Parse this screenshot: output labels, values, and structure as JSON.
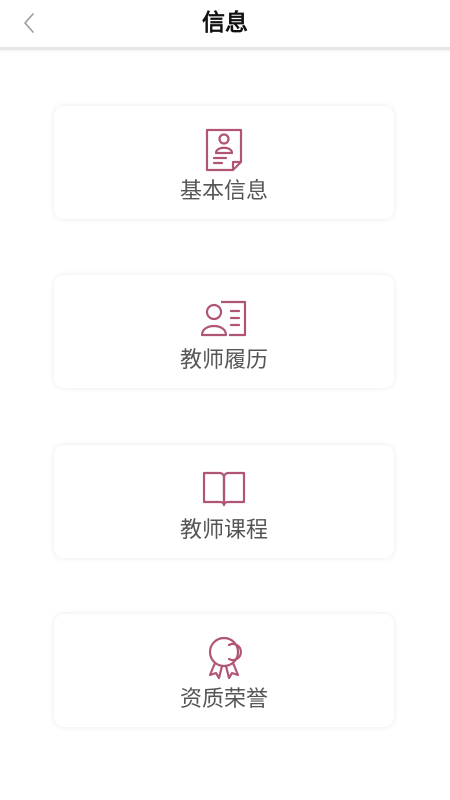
{
  "header": {
    "title": "信息"
  },
  "menu": {
    "items": [
      {
        "label": "基本信息",
        "icon": "id-document-icon"
      },
      {
        "label": "教师履历",
        "icon": "profile-card-icon"
      },
      {
        "label": "教师课程",
        "icon": "open-book-icon"
      },
      {
        "label": "资质荣誉",
        "icon": "award-medal-icon"
      }
    ]
  },
  "colors": {
    "accent": "#b05577",
    "label": "#555555",
    "title": "#111111"
  }
}
